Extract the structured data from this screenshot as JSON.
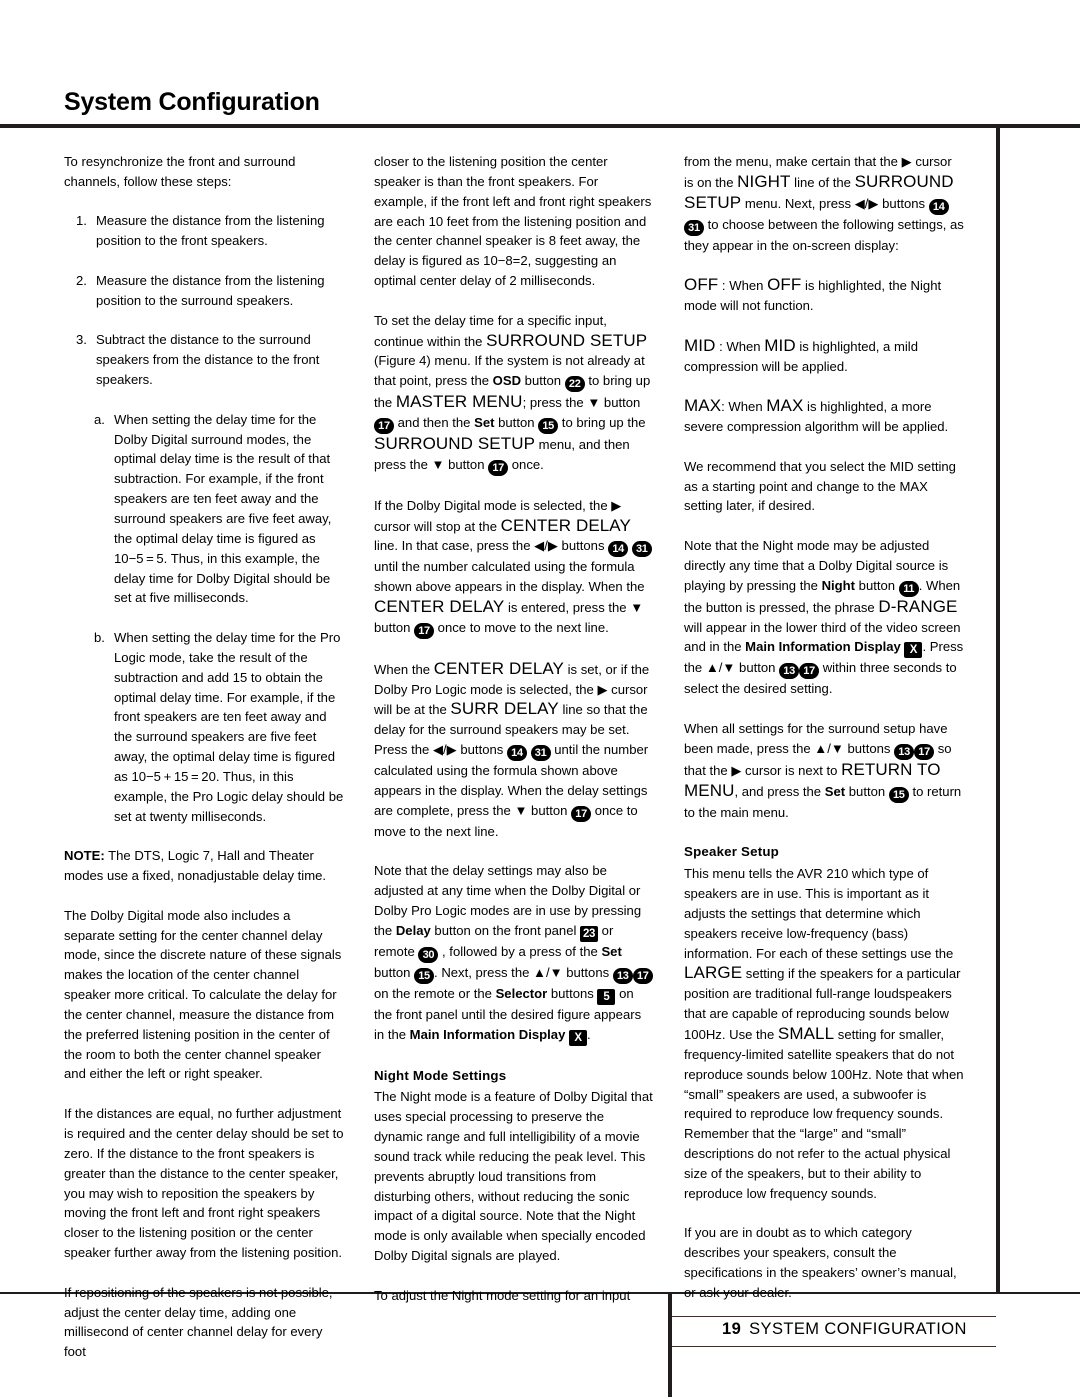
{
  "page": {
    "title": "System Configuration",
    "footer_page_number": "19",
    "footer_section": "SYSTEM CONFIGURATION"
  },
  "columns": {
    "col1": {
      "intro": "To resynchronize the front and surround channels, follow these steps:",
      "steps": [
        {
          "marker": "1.",
          "text": "Measure the distance from the listening position to the front speakers."
        },
        {
          "marker": "2.",
          "text": "Measure the distance from the listening position to the surround speakers."
        },
        {
          "marker": "3.",
          "text": "Subtract the distance to the surround speakers from the distance to the front speakers."
        }
      ],
      "substeps": [
        {
          "marker": "a.",
          "text": "When setting the delay time for the Dolby Digital surround modes, the optimal delay time is the result of that subtraction. For example, if the front speakers are ten feet away and the surround speakers are five feet away, the optimal delay time is figured as 10−5 = 5. Thus, in this example, the delay time for Dolby Digital should be set at five milliseconds."
        },
        {
          "marker": "b.",
          "text": "When setting the delay time for the Pro Logic mode, take the result of the subtraction and add 15 to obtain the optimal delay time. For example, if the front speakers are ten feet away and the surround speakers are five feet away, the optimal delay time is figured as 10−5 + 15 = 20. Thus, in this example, the Pro Logic delay should be set at twenty milliseconds."
        }
      ],
      "note_label": "NOTE:",
      "note_text": "The DTS, Logic 7, Hall and Theater modes use a fixed, nonadjustable delay time.",
      "para_center_delay": "The Dolby Digital mode also includes a separate setting for the center channel delay mode, since the discrete nature of these signals makes the location of the center channel speaker more critical. To calculate the delay for the center channel, measure the distance from the preferred listening position in the center of the room to both the center channel speaker and either the left or right speaker.",
      "para_distances_equal": "If the distances are equal, no further adjustment is required and the center delay should be set to zero. If the distance to the front speakers is greater than the distance to the center speaker, you may wish to reposition the speakers by moving the front left and front right speakers closer to the listening position or the center speaker further away from the listening position.",
      "para_repositioning": "If repositioning of the speakers is not possible, adjust the center delay time, adding one millisecond of center channel delay for every foot"
    },
    "col2": {
      "para_closer_1": "closer to the listening position the center speaker is than the front speakers. For example, if the front left and front right speakers are each 10 feet from the listening position and the center channel speaker is 8 feet away, the delay is figured as 10−8=2, suggesting an optimal center delay of 2 milliseconds.",
      "para_setdelay_a": "To set the delay time for a specific input, continue within the ",
      "osd_surround_setup": "SURROUND SETUP",
      "para_setdelay_b": " (Figure 4) menu. If the system is not already at that point, press the ",
      "btn_osd": "OSD",
      "para_setdelay_c": " button ",
      "badge_22": "22",
      "para_setdelay_d": " to bring up the ",
      "osd_master_menu": "MASTER MENU",
      "para_setdelay_e": "; press the ▼ button ",
      "badge_17a": "17",
      "para_setdelay_f": " and then the ",
      "btn_set": "Set",
      "para_setdelay_g": " button ",
      "badge_15a": "15",
      "para_setdelay_h": " to bring up the ",
      "osd_surround_setup2": "SURROUND SETUP",
      "para_setdelay_i": " menu, and then press the ▼ button ",
      "badge_17b": "17",
      "para_setdelay_j": " once.",
      "para_dd_a": "If the Dolby Digital mode is selected, the ▶ cursor will stop at the ",
      "osd_center_delay": "CENTER DELAY",
      "para_dd_b": " line. In that case, press the ◀/▶ buttons ",
      "badge_14a": "14",
      "badge_31a": "31",
      "para_dd_c": " until the number calculated using the formula shown above appears in the display. When the ",
      "osd_center_delay2": "CENTER DELAY",
      "para_dd_d": " is entered, press the ▼ button ",
      "badge_17c": "17",
      "para_dd_e": " once to move to the next line.",
      "para_surr_a": "When the ",
      "osd_center_delay3": "CENTER DELAY",
      "para_surr_b": " is set, or if the Dolby Pro Logic mode is selected, the ▶ cursor will be at the ",
      "osd_surr_delay": "SURR DELAY",
      "para_surr_c": " line so that the delay for the surround speakers may be set. Press the ◀/▶ buttons ",
      "badge_14b": "14",
      "badge_31b": "31",
      "para_surr_d": " until the number calculated using the formula shown above appears in the display. When the delay settings are complete, press the ▼ button ",
      "badge_17d": "17",
      "para_surr_e": " once to move to the next line.",
      "para_note_a": "Note that the delay settings may also be adjusted at any time when the Dolby Digital or Dolby Pro Logic modes are in use by pressing the ",
      "btn_delay": "Delay",
      "para_note_b": " button on the front panel ",
      "badge_sq_23": "23",
      "para_note_c": " or remote ",
      "badge_30": "30",
      "para_note_d": " , followed by a press of the ",
      "btn_set2": "Set",
      "para_note_e": " button ",
      "badge_15b": "15",
      "para_note_f": ". Next, press the ▲/▼ buttons ",
      "badge_13a": "13",
      "badge_17e": "17",
      "para_note_g": " on the remote or the ",
      "btn_selector": "Selector",
      "para_note_h": " buttons ",
      "badge_sq_5": "5",
      "para_note_i": " on the front panel until the desired figure appears in the ",
      "btn_main_info_display": "Main Information Display",
      "badge_sq_x": "X",
      "para_note_j": ".",
      "heading_night": "Night Mode Settings",
      "para_night": "The Night mode is a feature of Dolby Digital that uses special processing to preserve the dynamic range and full intelligibility of a movie sound track while reducing the peak level. This prevents abruptly loud transitions from disturbing others, without reducing the sonic impact of a digital source. Note that the Night mode is only available when specially encoded Dolby Digital signals are played.",
      "para_adjust": "To adjust the Night mode setting for an input"
    },
    "col3": {
      "para_from_a": "from the menu, make certain that the ▶ cursor is on the ",
      "osd_night": "NIGHT",
      "para_from_b": " line of the ",
      "osd_surround_setup": "SURROUND SETUP",
      "para_from_c": " menu. Next, press ◀/▶ buttons ",
      "badge_14": "14",
      "badge_31": "31",
      "para_from_d": " to choose between the following settings, as they appear in the on-screen display:",
      "osd_off": "OFF",
      "para_off_a": " : When ",
      "osd_off2": "OFF",
      "para_off_b": " is highlighted, the Night mode will not function.",
      "osd_mid": "MID",
      "para_mid_a": " : When ",
      "osd_mid2": "MID",
      "para_mid_b": " is highlighted, a mild compression will be applied.",
      "osd_max": "MAX",
      "para_max_a": ": When ",
      "osd_max2": "MAX",
      "para_max_b": " is highlighted, a more severe compression algorithm will be applied.",
      "para_recommend": "We recommend that you select the MID setting as a starting point and change to the MAX setting later, if desired.",
      "para_nightadj_a": "Note that the Night mode may be adjusted directly any time that a Dolby Digital source is playing by pressing the ",
      "btn_night": "Night",
      "para_nightadj_b": " button ",
      "badge_11": "11",
      "para_nightadj_c": ". When the button is pressed, the phrase ",
      "osd_drange": "D-RANGE",
      "para_nightadj_d": " will appear in the lower third of the video screen and in the ",
      "btn_main_info": "Main Information Display",
      "badge_sq_x": "X",
      "para_nightadj_e": ". Press the ▲/▼ button ",
      "badge_13": "13",
      "badge_17": "17",
      "para_nightadj_f": " within three seconds to select the desired setting.",
      "para_allsettings_a": "When all settings for the surround setup have been made, press the ▲/▼ buttons ",
      "badge_13b": "13",
      "badge_17b": "17",
      "para_allsettings_b": " so that the ▶ cursor is next to ",
      "osd_return_to_menu": "RETURN TO MENU",
      "para_allsettings_c": ", and press the ",
      "btn_set": "Set",
      "para_allsettings_d": " button ",
      "badge_15": "15",
      "para_allsettings_e": " to return to the main menu.",
      "heading_speaker": "Speaker Setup",
      "para_speaker_a": "This menu tells the AVR 210 which type of speakers are in use. This is important as it adjusts the settings that determine which speakers receive low-frequency (bass) information. For each of these settings use the ",
      "osd_large": "LARGE",
      "para_speaker_b": " setting if the speakers for a particular position are traditional full-range loudspeakers that are capable of reproducing sounds below 100Hz. Use the ",
      "osd_small": "SMALL",
      "para_speaker_c": " setting for smaller, frequency-limited satellite speakers that do not reproduce sounds below 100Hz. Note that when “small” speakers are used, a subwoofer is required to reproduce low frequency sounds. Remember that the “large” and “small” descriptions do not refer to the actual physical size of the speakers, but to their ability to reproduce low frequency sounds.",
      "para_speaker_d": "If you are in doubt as to which category describes your speakers, consult the specifications in the speakers’ owner’s manual, or ask your dealer."
    }
  }
}
